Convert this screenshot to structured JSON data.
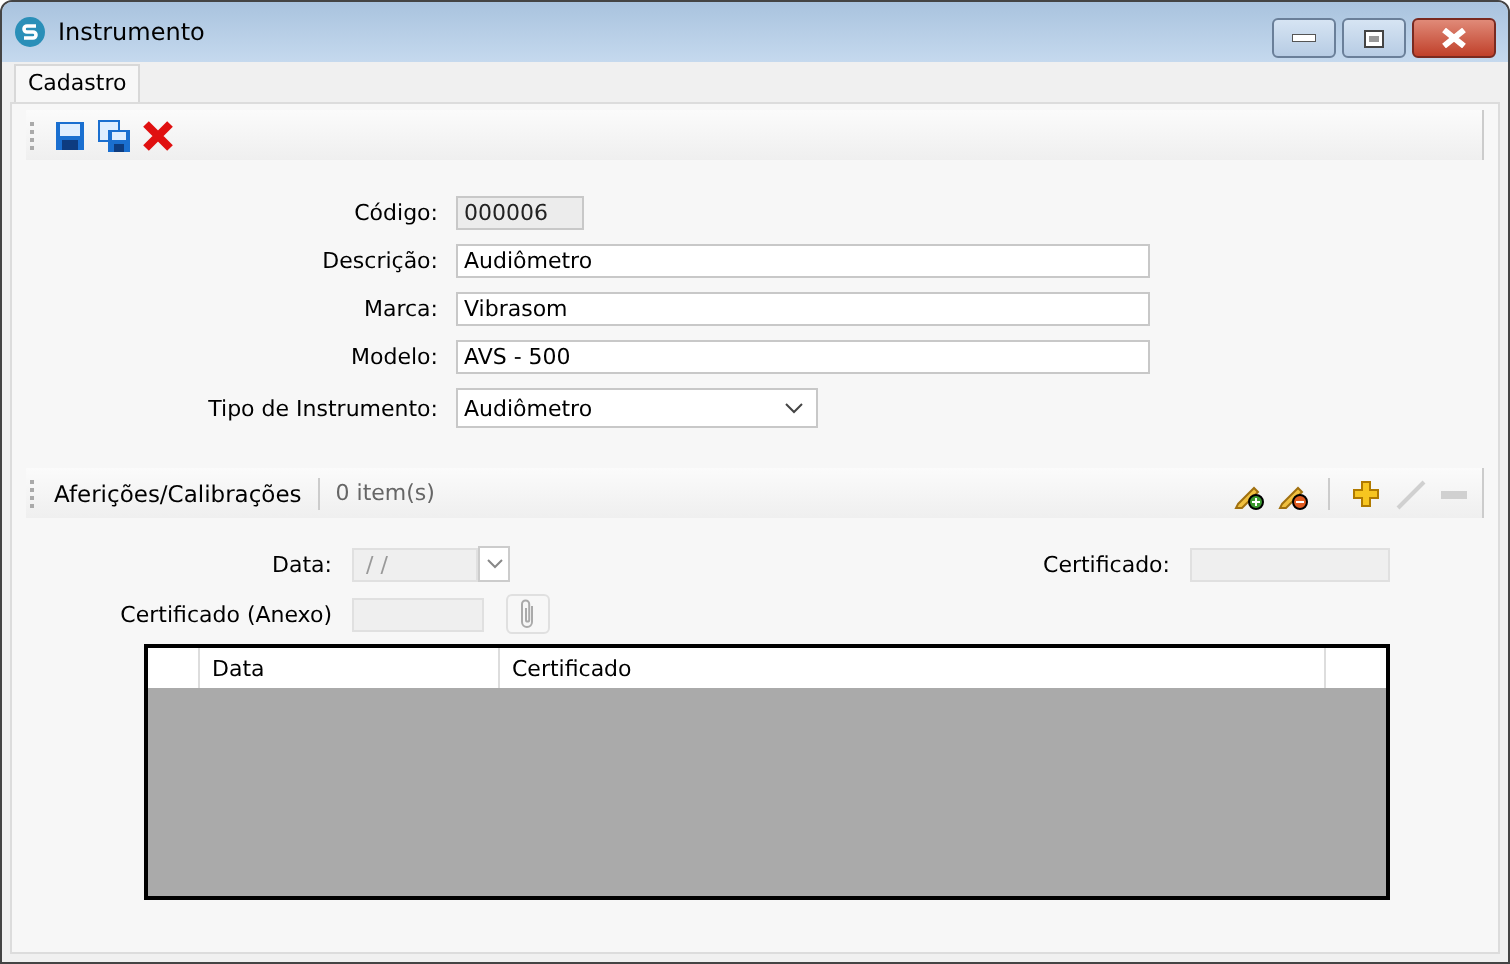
{
  "window": {
    "title": "Instrumento"
  },
  "tabs": [
    {
      "label": "Cadastro",
      "selected": true
    }
  ],
  "form": {
    "fields": [
      {
        "label": "Código:",
        "value": "000006",
        "kind": "text",
        "disabled": true
      },
      {
        "label": "Descrição:",
        "value": "Audiômetro",
        "kind": "text",
        "disabled": false
      },
      {
        "label": "Marca:",
        "value": "Vibrasom",
        "kind": "text",
        "disabled": false
      },
      {
        "label": "Modelo:",
        "value": "AVS - 500",
        "kind": "text",
        "disabled": false
      },
      {
        "label": "Tipo de Instrumento:",
        "value": "Audiômetro",
        "kind": "select",
        "disabled": false
      }
    ]
  },
  "section": {
    "title": "Aferições/Calibrações",
    "count": "0 item(s)",
    "actions": [
      {
        "kind": "pencil-add",
        "disabled": false
      },
      {
        "kind": "pencil-remove",
        "disabled": false
      },
      {
        "kind": "add",
        "disabled": false
      },
      {
        "kind": "edit",
        "disabled": true
      },
      {
        "kind": "remove",
        "disabled": true
      }
    ],
    "date": {
      "label": "Data:",
      "value": "/ /",
      "disabled": true
    },
    "certificate": {
      "label": "Certificado:",
      "disabled": true
    },
    "attachment": {
      "label": "Certificado (Anexo)",
      "disabled": true
    },
    "table": {
      "columns": [
        "Data",
        "Certificado"
      ]
    }
  }
}
